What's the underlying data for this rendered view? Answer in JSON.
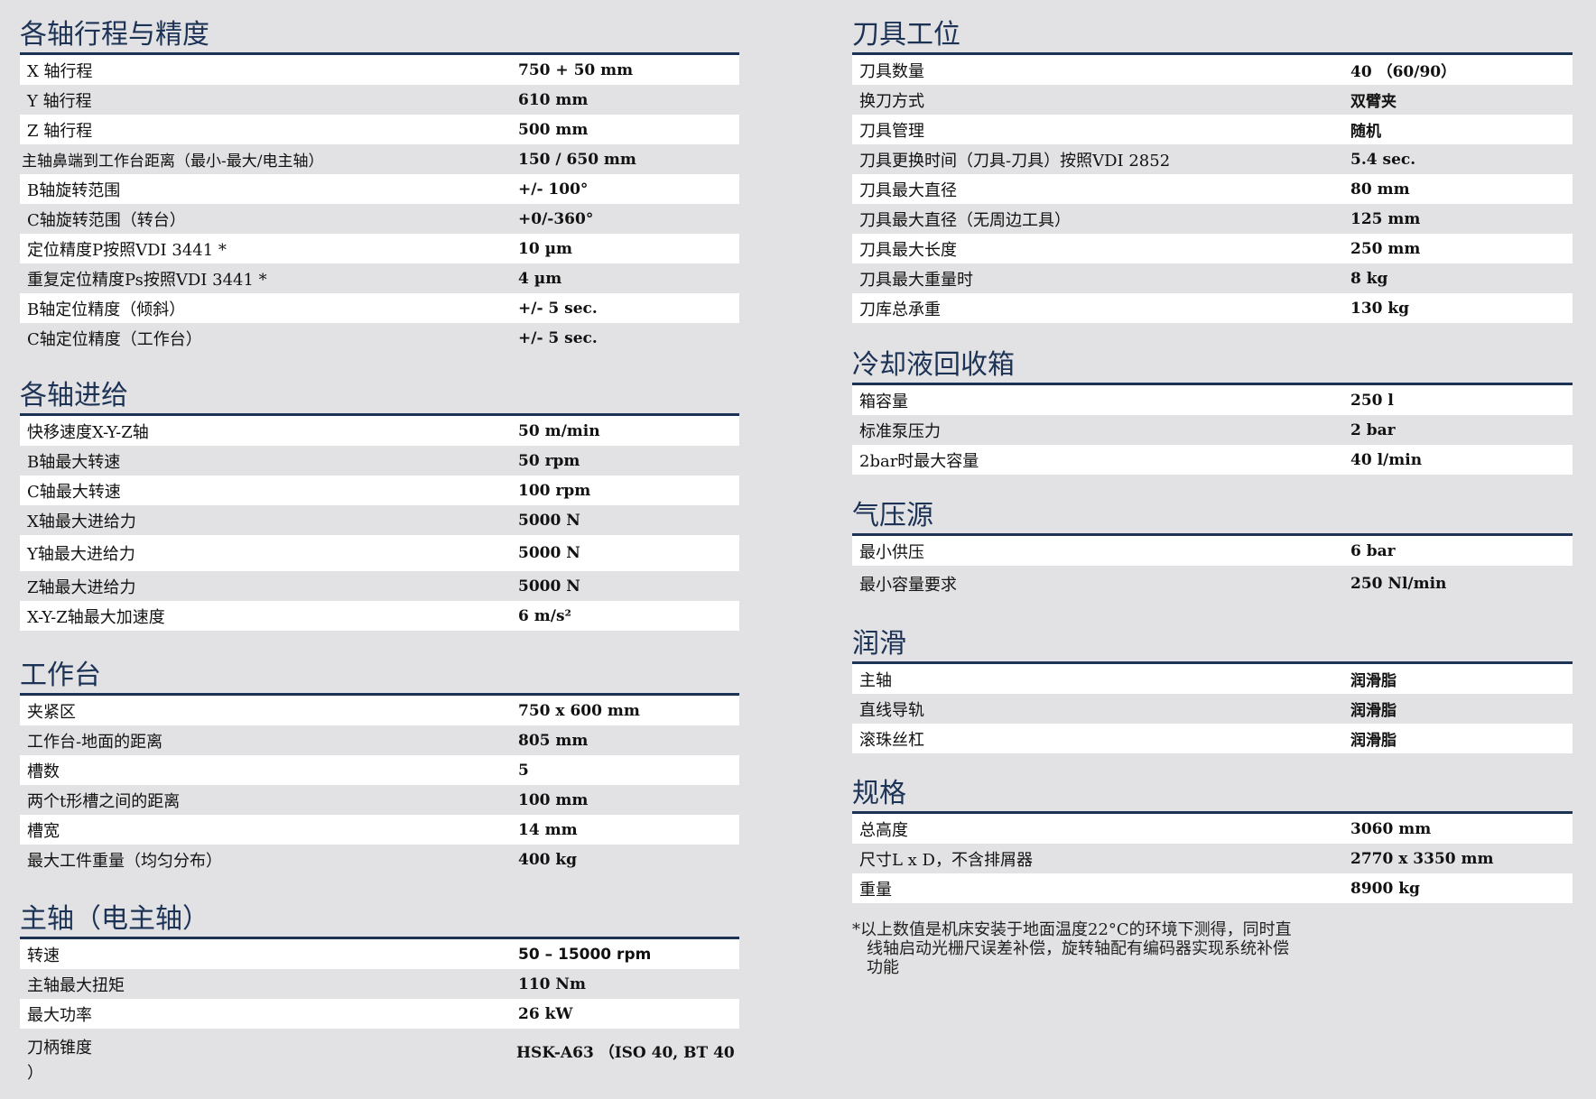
{
  "left": [
    {
      "title": "各轴行程与精度",
      "rows": [
        {
          "label": "X 轴行程",
          "value": "750 + 50 mm"
        },
        {
          "label": "Y 轴行程",
          "value": "610 mm"
        },
        {
          "label": "Z 轴行程",
          "value": "500 mm"
        },
        {
          "label": "主轴鼻端到工作台距离（最小-最大/电主轴）",
          "value": "150 / 650 mm"
        },
        {
          "label": "B轴旋转范围",
          "value": " +/- 100°"
        },
        {
          "label": "C轴旋转范围（转台）",
          "value": " +0/-360°"
        },
        {
          "label": "定位精度P按照VDI 3441 *",
          "value": "10 µm"
        },
        {
          "label": "重复定位精度Ps按照VDI 3441 *",
          "value": "4 µm"
        },
        {
          "label": "B轴定位精度（倾斜）",
          "value": "+/- 5 sec."
        },
        {
          "label": "C轴定位精度（工作台）",
          "value": "+/- 5 sec."
        }
      ]
    },
    {
      "title": "各轴进给",
      "rows": [
        {
          "label": "快移速度X-Y-Z轴",
          "value": "50 m/min"
        },
        {
          "label": "B轴最大转速",
          "value": "50 rpm"
        },
        {
          "label": "C轴最大转速",
          "value": "100 rpm"
        },
        {
          "label": "X轴最大进给力",
          "value": "5000 N"
        },
        {
          "label": "Y轴最大进给力",
          "value": "5000 N"
        },
        {
          "label": "Z轴最大进给力",
          "value": "5000 N"
        },
        {
          "label": "X-Y-Z轴最大加速度",
          "value": "6 m/s²"
        }
      ]
    },
    {
      "title": "工作台",
      "rows": [
        {
          "label": "夹紧区",
          "value": "750 x 600 mm"
        },
        {
          "label": "工作台-地面的距离",
          "value": "805 mm"
        },
        {
          "label": "槽数",
          "value": "5"
        },
        {
          "label": "两个t形槽之间的距离",
          "value": "100 mm"
        },
        {
          "label": "槽宽",
          "value": "14 mm"
        },
        {
          "label": "最大工件重量（均匀分布）",
          "value": "400 kg"
        }
      ]
    },
    {
      "title": "主轴（电主轴）",
      "rows": [
        {
          "label": "转速",
          "value": "50 – 15000 rpm"
        },
        {
          "label": "主轴最大扭矩",
          "value": "110 Nm"
        },
        {
          "label": "最大功率",
          "value": "26 kW"
        },
        {
          "label": "刀柄锥度 ）",
          "value": "HSK-A63 （ISO 40, BT 40"
        }
      ]
    }
  ],
  "right": [
    {
      "title": "刀具工位",
      "rows": [
        {
          "label": "刀具数量",
          "value": "40 （60/90）"
        },
        {
          "label": "换刀方式",
          "value": "双臂夹"
        },
        {
          "label": "刀具管理",
          "value": "随机"
        },
        {
          "label": "刀具更换时间（刀具-刀具）按照VDI 2852",
          "value": "5.4 sec."
        },
        {
          "label": "刀具最大直径",
          "value": "80 mm"
        },
        {
          "label": "刀具最大直径（无周边工具）",
          "value": "125 mm"
        },
        {
          "label": "刀具最大长度",
          "value": "250 mm"
        },
        {
          "label": "刀具最大重量时",
          "value": "8 kg"
        },
        {
          "label": "刀库总承重",
          "value": "130 kg"
        }
      ]
    },
    {
      "title": "冷却液回收箱",
      "rows": [
        {
          "label": "箱容量",
          "value": "250 l"
        },
        {
          "label": "标准泵压力",
          "value": "2 bar"
        },
        {
          "label": "2bar时最大容量",
          "value": "40 l/min"
        }
      ]
    },
    {
      "title": "气压源",
      "rows": [
        {
          "label": "最小供压",
          "value": "6 bar"
        },
        {
          "label": "最小容量要求",
          "value": "250 Nl/min"
        }
      ]
    },
    {
      "title": "润滑",
      "rows": [
        {
          "label": "主轴",
          "value": "润滑脂"
        },
        {
          "label": "直线导轨",
          "value": "润滑脂"
        },
        {
          "label": "滚珠丝杠",
          "value": "润滑脂"
        }
      ]
    },
    {
      "title": "规格",
      "rows": [
        {
          "label": "总高度",
          "value": "3060 mm"
        },
        {
          "label": "尺寸L x D，不含排屑器",
          "value": "2770 x 3350 mm"
        },
        {
          "label": "重量",
          "value": "8900 kg"
        }
      ]
    }
  ],
  "footnote": {
    "line1": "*以上数值是机床安装于地面温度22°C的环境下测得，同时直",
    "line2": "线轴启动光栅尺误差补偿，旋转轴配有编码器实现系统补偿",
    "line3": "功能"
  }
}
